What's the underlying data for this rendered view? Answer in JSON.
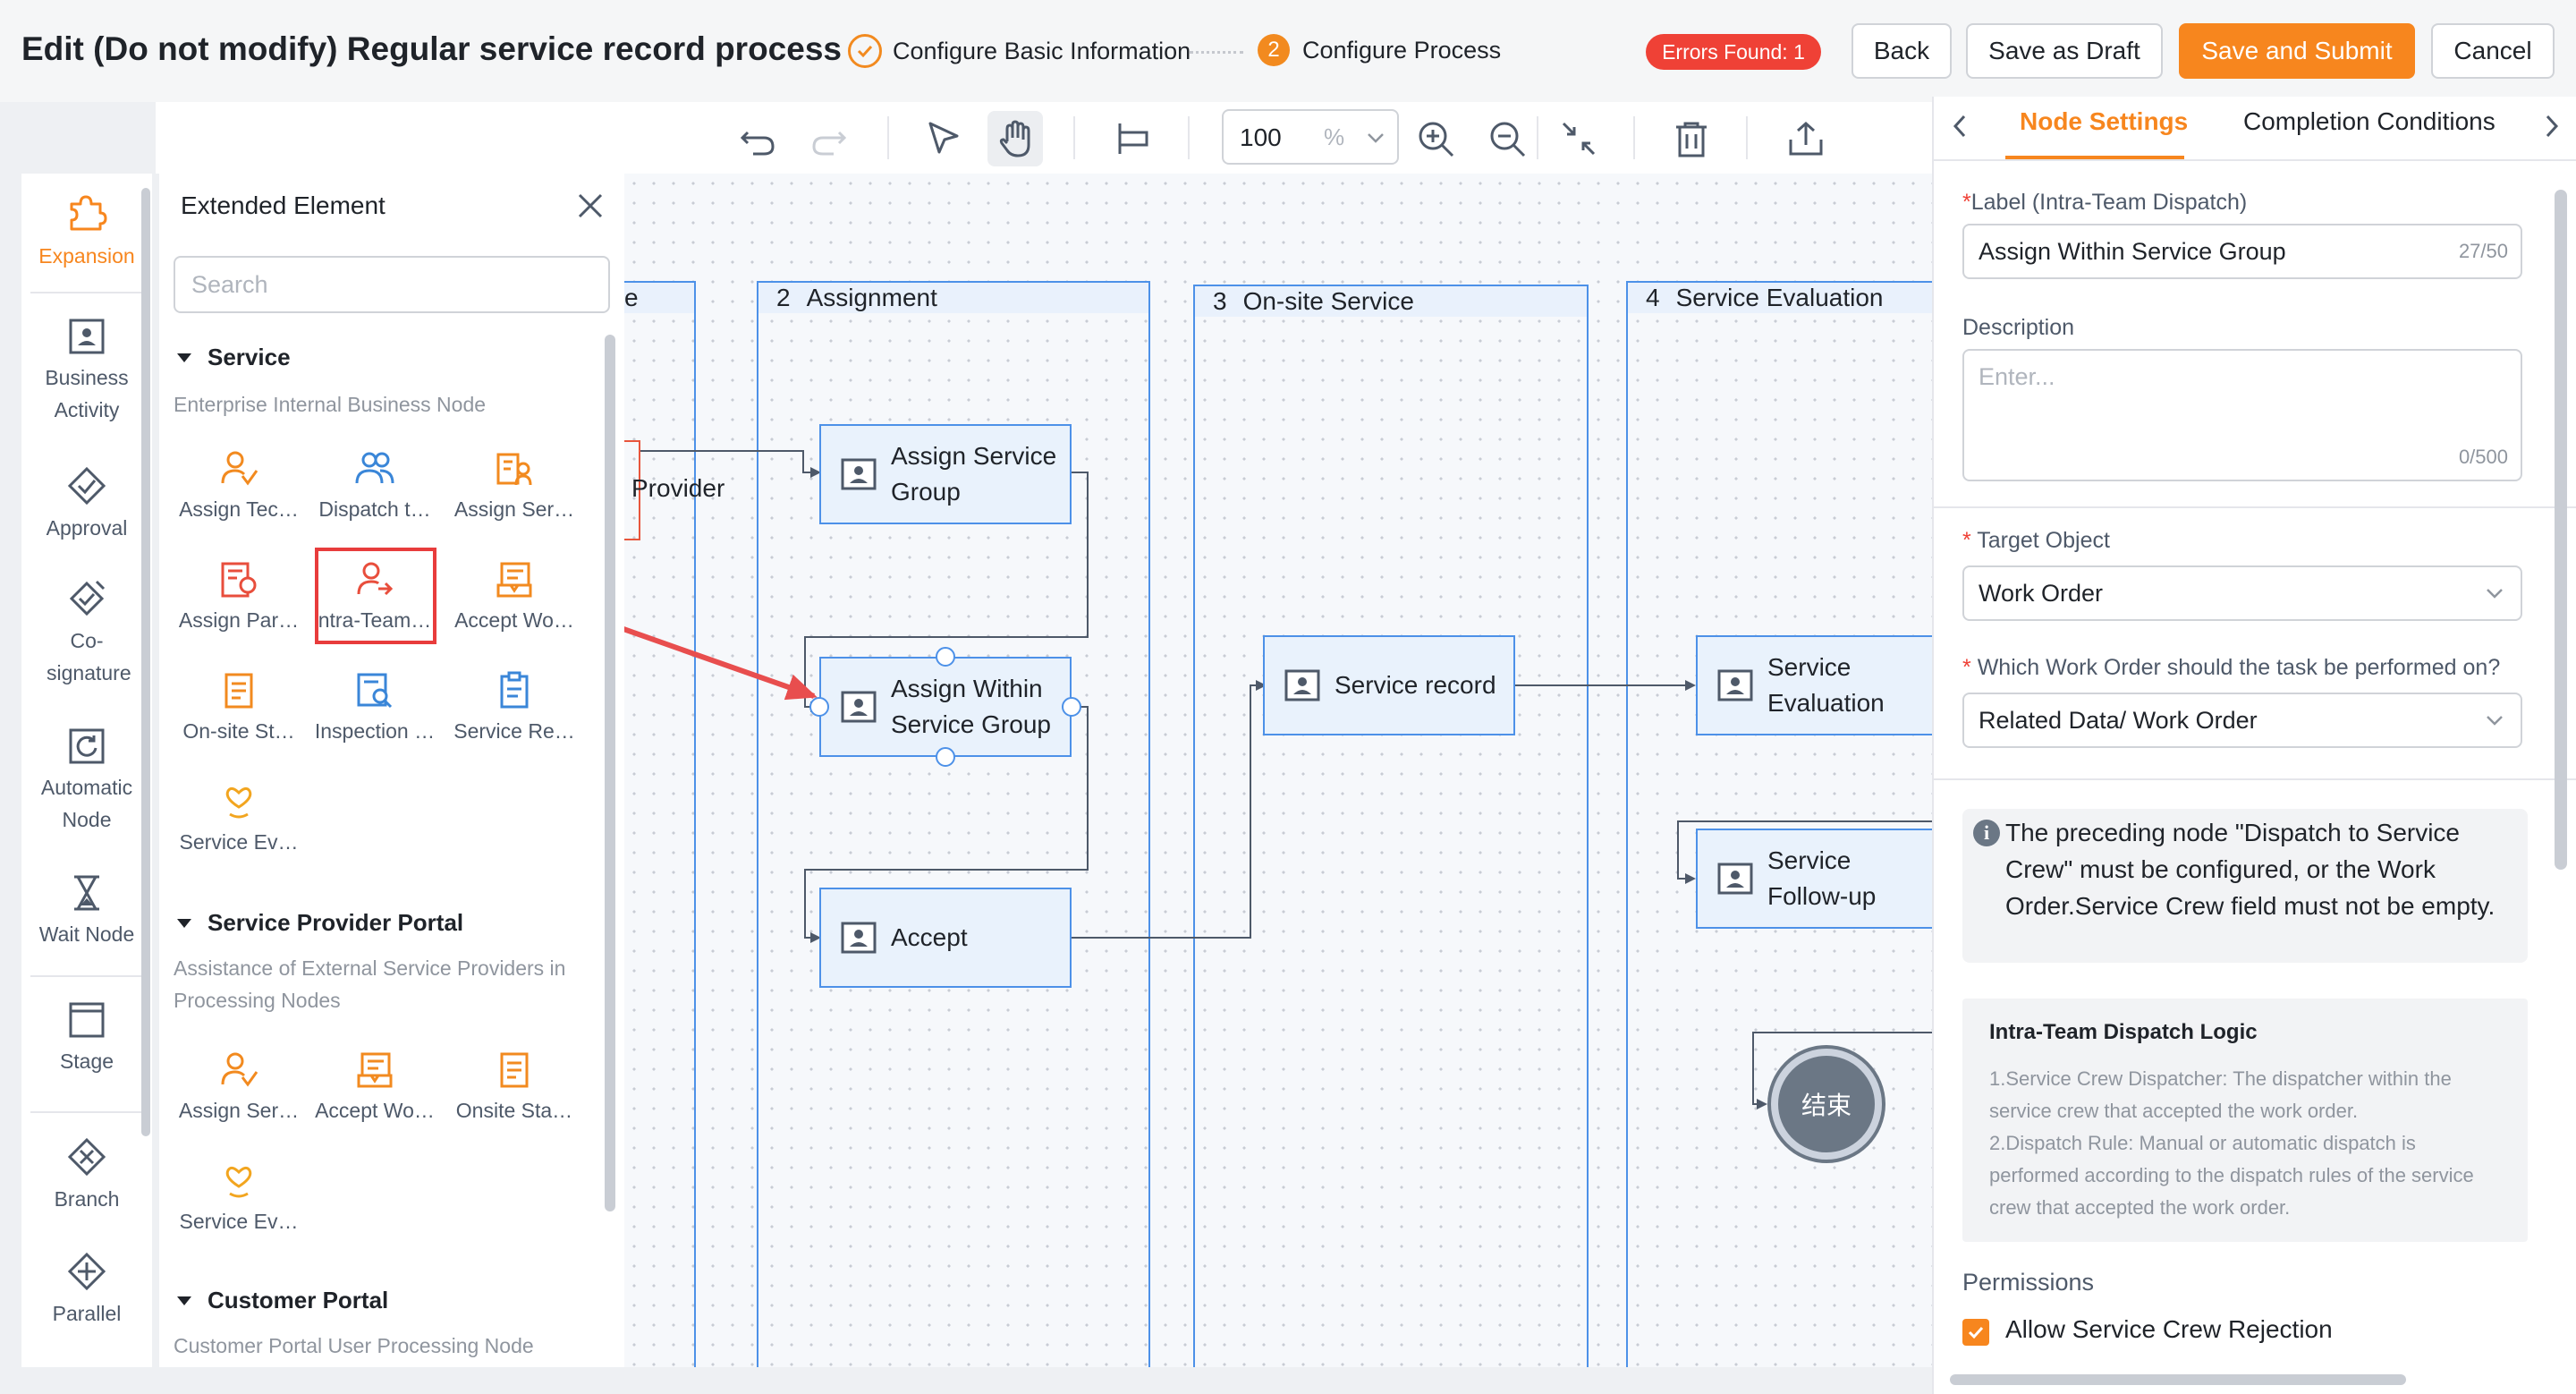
{
  "header": {
    "title": "Edit (Do not modify) Regular service record process",
    "steps": [
      {
        "label": "Configure Basic Information"
      },
      {
        "number": "2",
        "label": "Configure Process"
      }
    ],
    "errors_badge": "Errors Found: 1",
    "buttons": {
      "back": "Back",
      "save_draft": "Save as Draft",
      "save_submit": "Save and Submit",
      "cancel": "Cancel"
    },
    "accent_color": "#f7861e"
  },
  "rail": {
    "items": [
      {
        "label": "Expansion",
        "icon": "puzzle-icon",
        "active": true
      },
      {
        "label": "Business Activity",
        "icon": "business-activity-icon"
      },
      {
        "label": "Approval",
        "icon": "approval-icon"
      },
      {
        "label": "Co-signature",
        "icon": "co-signature-icon"
      },
      {
        "label": "Automatic Node",
        "icon": "automatic-node-icon"
      },
      {
        "label": "Wait Node",
        "icon": "hourglass-icon"
      },
      {
        "label": "Stage",
        "icon": "stage-icon"
      },
      {
        "label": "Branch",
        "icon": "branch-icon"
      },
      {
        "label": "Parallel",
        "icon": "parallel-icon"
      }
    ]
  },
  "extended": {
    "title": "Extended Element",
    "search_placeholder": "Search",
    "sections": [
      {
        "title": "Service",
        "desc": "Enterprise Internal Business Node",
        "items": [
          "Assign Tec…",
          "Dispatch t…",
          "Assign Ser…",
          "Assign Par…",
          "ntra-Team…",
          "Accept Wo…",
          "On-site St…",
          "Inspection …",
          "Service Re…",
          "Service Ev…"
        ]
      },
      {
        "title": "Service Provider Portal",
        "desc": "Assistance of External Service Providers in Processing Nodes",
        "items": [
          "Assign Ser…",
          "Accept Wo…",
          "Onsite Sta…",
          "Service Ev…"
        ]
      },
      {
        "title": "Customer Portal",
        "desc": "Customer Portal User Processing Node",
        "items": []
      }
    ]
  },
  "toolbar": {
    "zoom_value": "100",
    "zoom_unit": "%"
  },
  "canvas": {
    "lane_partial_label": "e",
    "partial_node_label": "Provider",
    "lanes": [
      {
        "number": "2",
        "title": "Assignment"
      },
      {
        "number": "3",
        "title": "On-site Service"
      },
      {
        "number": "4",
        "title": "Service Evaluation"
      }
    ],
    "nodes": {
      "assign_service_group": "Assign Service Group",
      "assign_within": "Assign Within Service Group",
      "accept": "Accept",
      "service_record": "Service record",
      "service_evaluation": "Service Evaluation",
      "service_followup": "Service Follow-up",
      "end": "结束"
    }
  },
  "right_panel": {
    "tabs": [
      "Node Settings",
      "Completion Conditions"
    ],
    "label_field": {
      "label": "Label (Intra-Team Dispatch)",
      "value": "Assign Within Service Group",
      "count": "27/50"
    },
    "description": {
      "label": "Description",
      "placeholder": "Enter...",
      "count": "0/500"
    },
    "target_object": {
      "label": "Target Object",
      "value": "Work Order"
    },
    "which_work_order": {
      "label": "Which Work Order should the task be performed on?",
      "value": "Related Data/ Work Order"
    },
    "info": "The preceding node \"Dispatch to Service Crew\" must be configured, or the Work Order.Service Crew field must not be empty.",
    "logic": {
      "title": "Intra-Team Dispatch Logic",
      "line1": "1.Service Crew Dispatcher: The dispatcher within the service crew that accepted the work order.",
      "line2": "2.Dispatch Rule: Manual or automatic dispatch is performed according to the dispatch rules of the service crew that accepted the work order."
    },
    "permissions": {
      "label": "Permissions",
      "allow_rejection": "Allow Service Crew Rejection",
      "allow_rejection_checked": true
    }
  }
}
